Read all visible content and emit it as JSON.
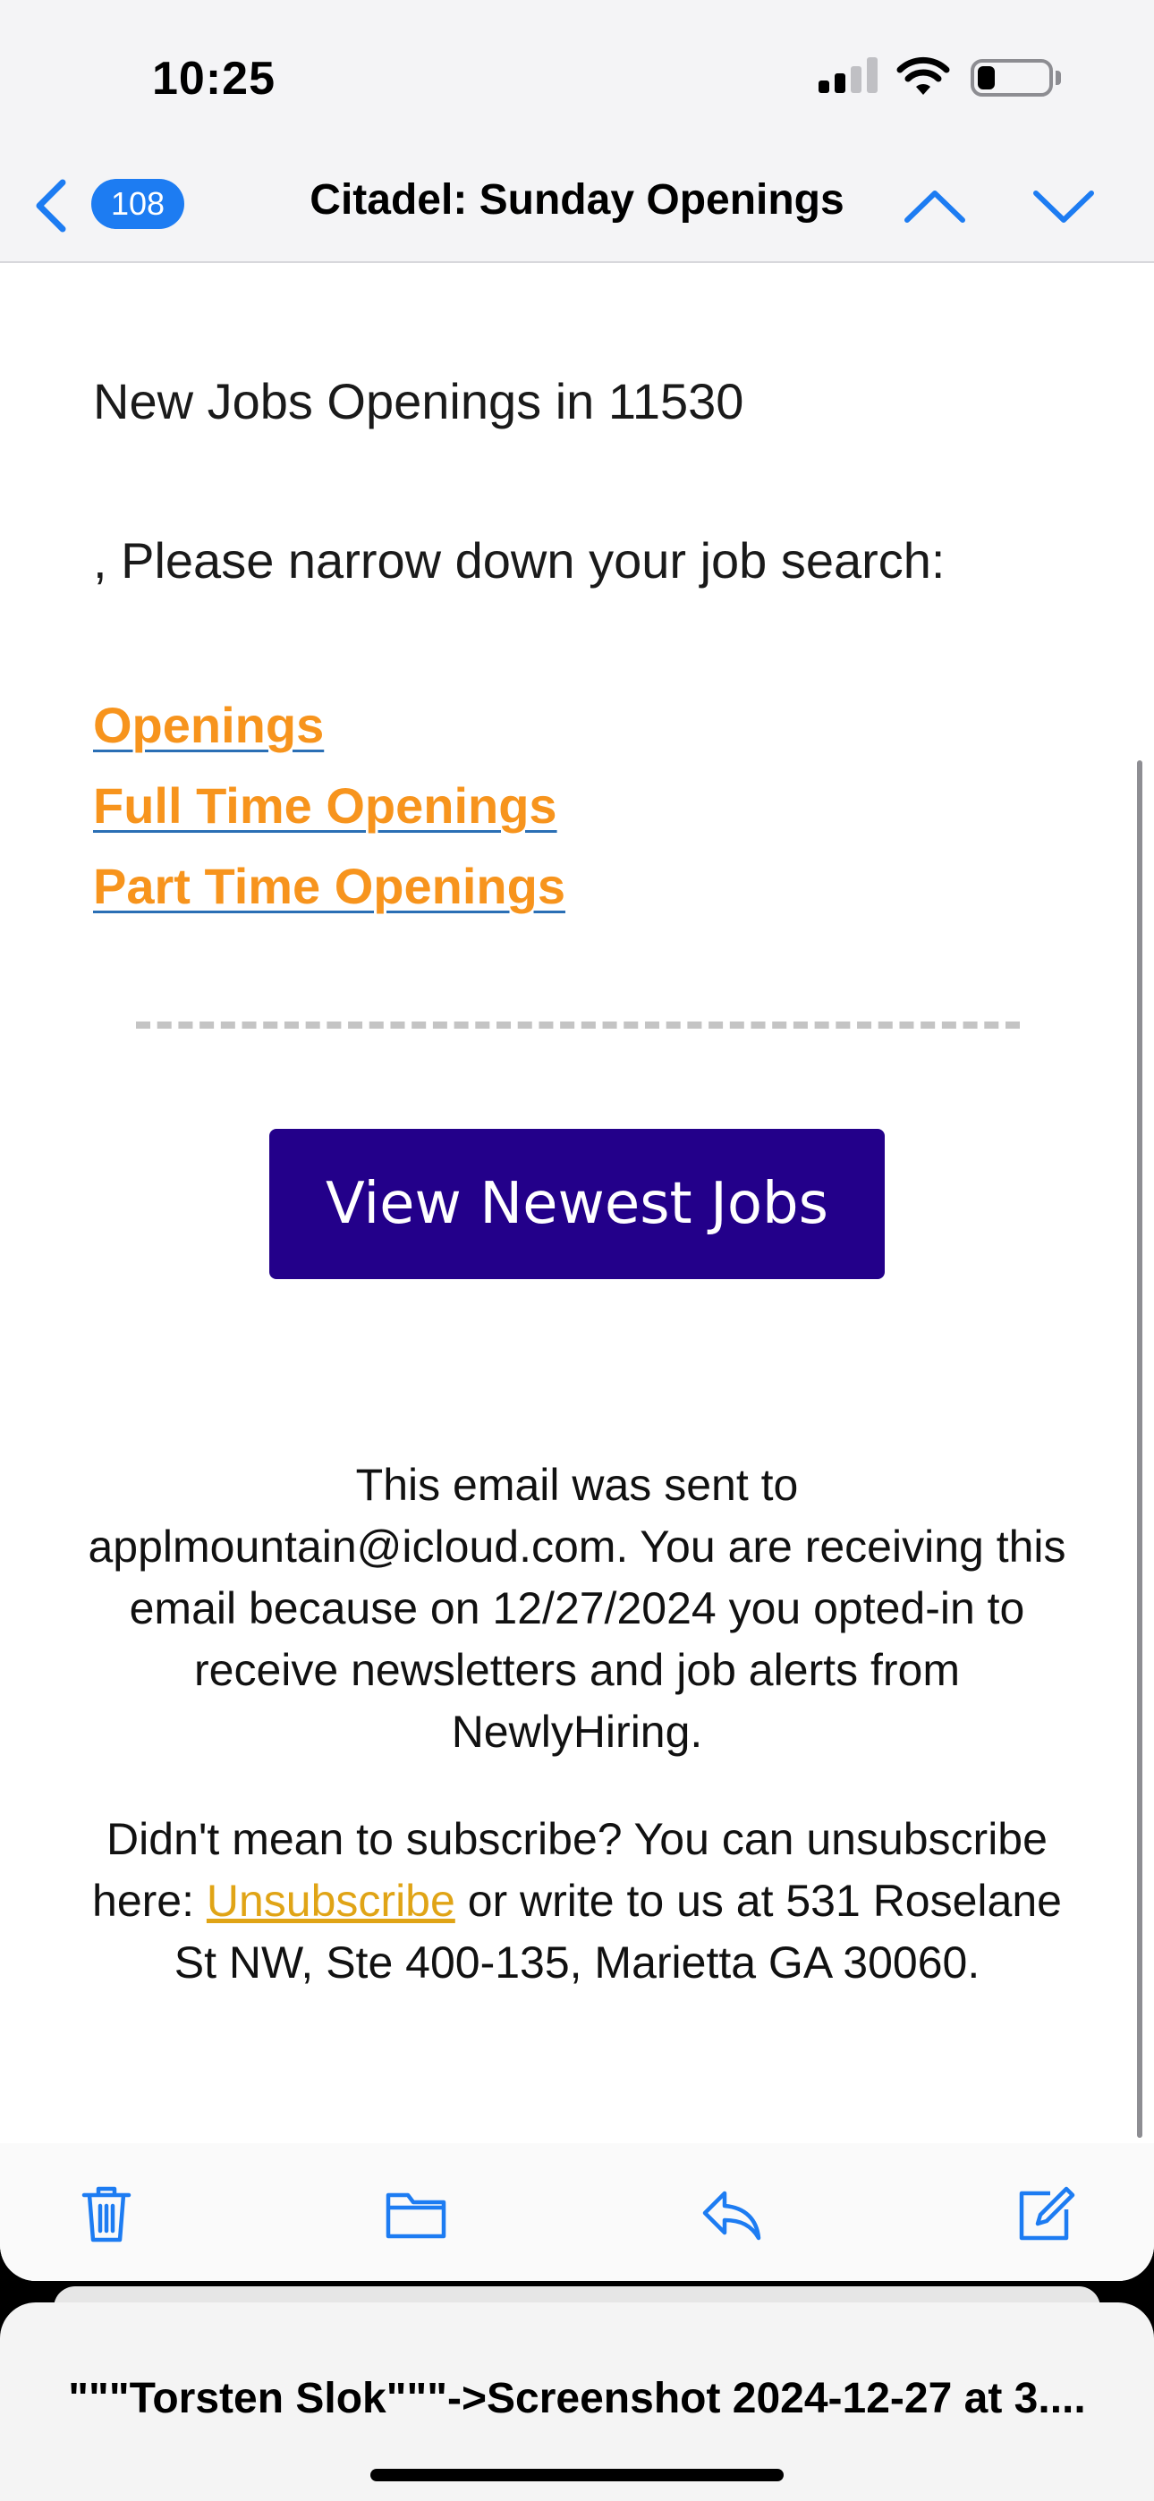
{
  "status_bar": {
    "time": "10:25",
    "signal_icon": "cellular-signal-icon",
    "wifi_icon": "wifi-icon",
    "battery_icon": "battery-icon",
    "battery_level": 0.25
  },
  "nav": {
    "back_icon": "chevron-left-icon",
    "unread_count": "108",
    "title": "Citadel: Sunday Openings",
    "prev_icon": "chevron-up-icon",
    "next_icon": "chevron-down-icon"
  },
  "email": {
    "headline": "New Jobs Openings in 11530",
    "narrow_text": ", Please narrow down your job search:",
    "links": [
      "Openings",
      "Full Time Openings",
      "Part Time Openings"
    ],
    "cta_label": "View Newest Jobs",
    "footer_sent": "This email was sent to applmountain@icloud.com. You are receiving this email because on 12/27/2024 you opted-in to receive newsletters and job alerts from NewlyHiring.",
    "footer_unsub_before": "Didn't mean to subscribe? You can unsubscribe here: ",
    "footer_unsub_link": "Unsubscribe",
    "footer_unsub_after": " or write to us at 531 Roselane St NW, Ste 400-135, Marietta GA 30060.",
    "link_color": "#f7941d",
    "cta_color": "#23008a",
    "unsub_color": "#e0a416"
  },
  "toolbar": {
    "items": [
      "trash-icon",
      "folder-icon",
      "reply-icon",
      "compose-icon"
    ],
    "accent": "#1d7cf2"
  },
  "share_sheet": {
    "title": "\"\"\"Torsten Slok\"\"\"->Screenshot 2024-12-27 at 3...."
  }
}
